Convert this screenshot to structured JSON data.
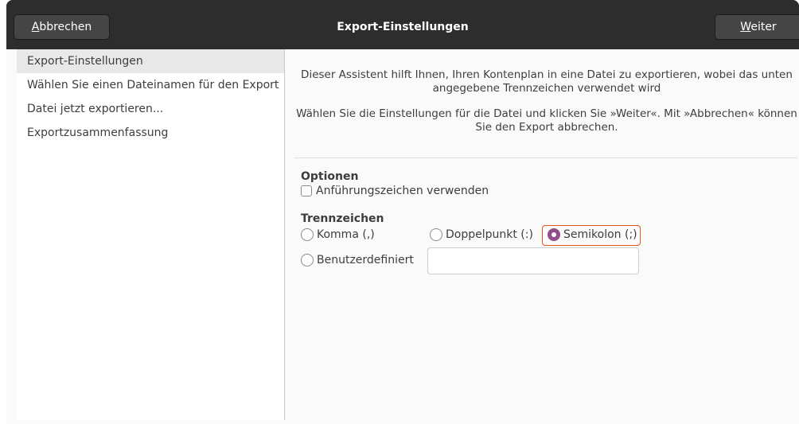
{
  "header": {
    "cancel_mnemonic": "A",
    "cancel_rest": "bbrechen",
    "title": "Export-Einstellungen",
    "next_mnemonic": "W",
    "next_rest": "eiter"
  },
  "sidebar": {
    "items": [
      {
        "label": "Export-Einstellungen"
      },
      {
        "label": "Wählen Sie einen Dateinamen für den Export"
      },
      {
        "label": "Datei jetzt exportieren..."
      },
      {
        "label": "Exportzusammenfassung"
      }
    ]
  },
  "main": {
    "intro_1": "Dieser Assistent hilft Ihnen, Ihren Kontenplan in eine Datei zu exportieren, wobei das unten angegebene Trennzeichen verwendet wird",
    "intro_2": "Wählen Sie die Einstellungen für die Datei und klicken Sie »Weiter«. Mit »Abbrechen« können Sie den Export abbrechen.",
    "options_title": "Optionen",
    "quote_label": "Anführungszeichen verwenden",
    "separator_title": "Trennzeichen",
    "radio_comma": "Komma (,)",
    "radio_colon": "Doppelpunkt (:)",
    "radio_semicolon": "Semikolon (;)",
    "radio_custom": "Benutzerdefiniert",
    "custom_value": ""
  },
  "colors": {
    "accent": "#924d8b",
    "focus": "#e95420",
    "headerbar": "#2d2d2d"
  }
}
